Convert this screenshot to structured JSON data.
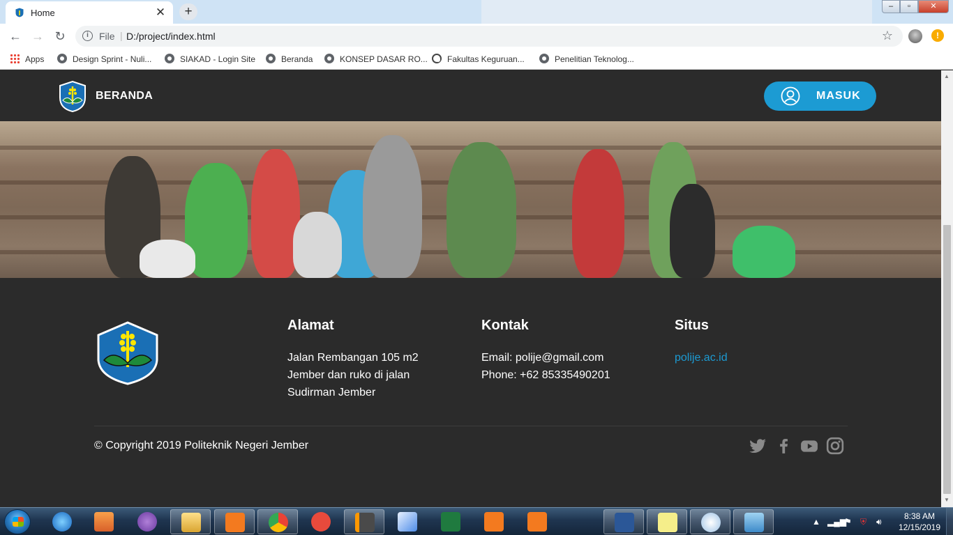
{
  "browser": {
    "tab_title": "Home",
    "tab_close": "✕",
    "new_tab": "+",
    "nav": {
      "back": "←",
      "forward": "→",
      "reload": "↻"
    },
    "omnibox": {
      "scheme": "File",
      "url": "D:/project/index.html",
      "info": "i"
    },
    "bookmark_star": "☆",
    "alert_badge": "!",
    "window_controls": {
      "minimize": "‒",
      "maximize": "▫",
      "close": "✕"
    }
  },
  "bookmarks": [
    {
      "label": "Apps",
      "icon": "apps-grid-icon"
    },
    {
      "label": "Design Sprint - Nuli...",
      "icon": "globe-icon"
    },
    {
      "label": "SIAKAD - Login Site",
      "icon": "globe-icon"
    },
    {
      "label": "Beranda",
      "icon": "globe-icon"
    },
    {
      "label": "KONSEP DASAR RO...",
      "icon": "globe-icon"
    },
    {
      "label": "Fakultas Keguruan...",
      "icon": "moon-icon"
    },
    {
      "label": "Penelitian Teknolog...",
      "icon": "globe-icon"
    }
  ],
  "site": {
    "navbar": {
      "brand": "BERANDA",
      "login_label": "MASUK"
    },
    "footer": {
      "address": {
        "heading": "Alamat",
        "lines": [
          "Jalan Rembangan 105 m2",
          "Jember dan ruko di jalan",
          "Sudirman Jember"
        ]
      },
      "contact": {
        "heading": "Kontak",
        "email": "Email: polije@gmail.com",
        "phone": "Phone: +62 85335490201"
      },
      "site": {
        "heading": "Situs",
        "link": "polije.ac.id"
      },
      "copyright": "© Copyright 2019 Politeknik Negeri Jember",
      "social": [
        "twitter-icon",
        "facebook-icon",
        "youtube-icon",
        "instagram-icon"
      ]
    }
  },
  "taskbar": {
    "clock_time": "8:38 AM",
    "clock_date": "12/15/2019",
    "apps": [
      "ie-icon",
      "media-player-icon",
      "github-desktop-icon",
      "file-explorer-icon",
      "xampp-icon",
      "chrome-icon",
      "pocket-app-icon",
      "sublime-text-icon",
      "pen-app-icon",
      "excel-icon",
      "screenshot-icon",
      "camera-icon",
      "triangle-app-icon",
      "word-icon",
      "sticky-notes-icon",
      "paint-icon",
      "photo-viewer-icon"
    ]
  },
  "colors": {
    "accent": "#1c9bd3",
    "page_bg": "#2b2b2b",
    "text": "#ffffff"
  }
}
